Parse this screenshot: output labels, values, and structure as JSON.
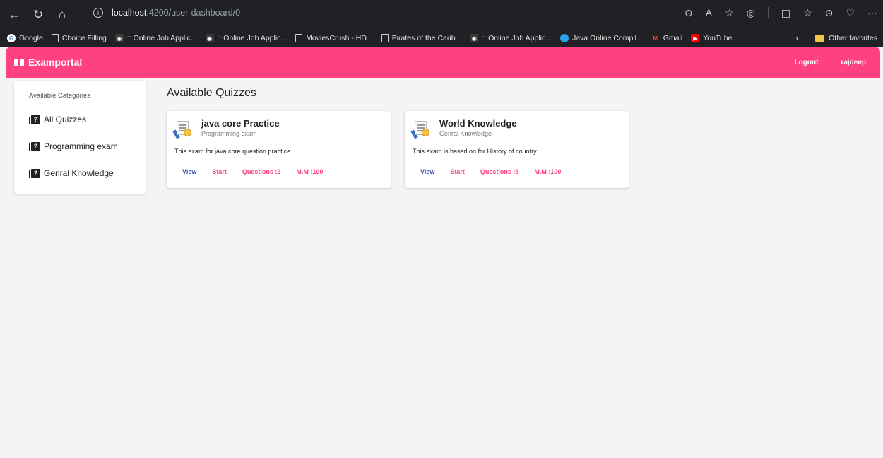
{
  "browser": {
    "url_host": "localhost",
    "url_path": ":4200/user-dashboard/0",
    "bookmarks": [
      {
        "label": "Google",
        "icon": "google-icon"
      },
      {
        "label": "Choice Filling",
        "icon": "page-icon"
      },
      {
        "label": ":: Online Job Applic...",
        "icon": "job-icon"
      },
      {
        "label": ":: Online Job Applic...",
        "icon": "job-icon"
      },
      {
        "label": "MoviesCrush - HD...",
        "icon": "page-icon"
      },
      {
        "label": "Pirates of the Carib...",
        "icon": "page-icon"
      },
      {
        "label": ":: Online Job Applic...",
        "icon": "job-icon"
      },
      {
        "label": "Java Online Compil...",
        "icon": "java-icon"
      },
      {
        "label": "Gmail",
        "icon": "gmail-icon"
      },
      {
        "label": "YouTube",
        "icon": "youtube-icon"
      }
    ],
    "other_favorites": "Other favorites"
  },
  "app": {
    "brand": "Examportal",
    "accent": "#ff4081",
    "nav": {
      "logout": "Logout",
      "user": "rajdeep"
    }
  },
  "sidebar": {
    "heading": "Available Categories",
    "items": [
      {
        "label": "All Quizzes"
      },
      {
        "label": "Programming exam"
      },
      {
        "label": "Genral Knowledge"
      }
    ]
  },
  "main": {
    "title": "Available Quizzes",
    "quizzes": [
      {
        "title": "java core Practice",
        "category": "Programming exam",
        "description": "This exam for java core question practice",
        "view": "View",
        "start": "Start",
        "questions": "Questions :2",
        "marks": "M.M :100"
      },
      {
        "title": "World Knowledge",
        "category": "Genral Knowledge",
        "description": "This exam is based on for History of country",
        "view": "View",
        "start": "Start",
        "questions": "Questions :5",
        "marks": "M.M :100"
      }
    ]
  }
}
